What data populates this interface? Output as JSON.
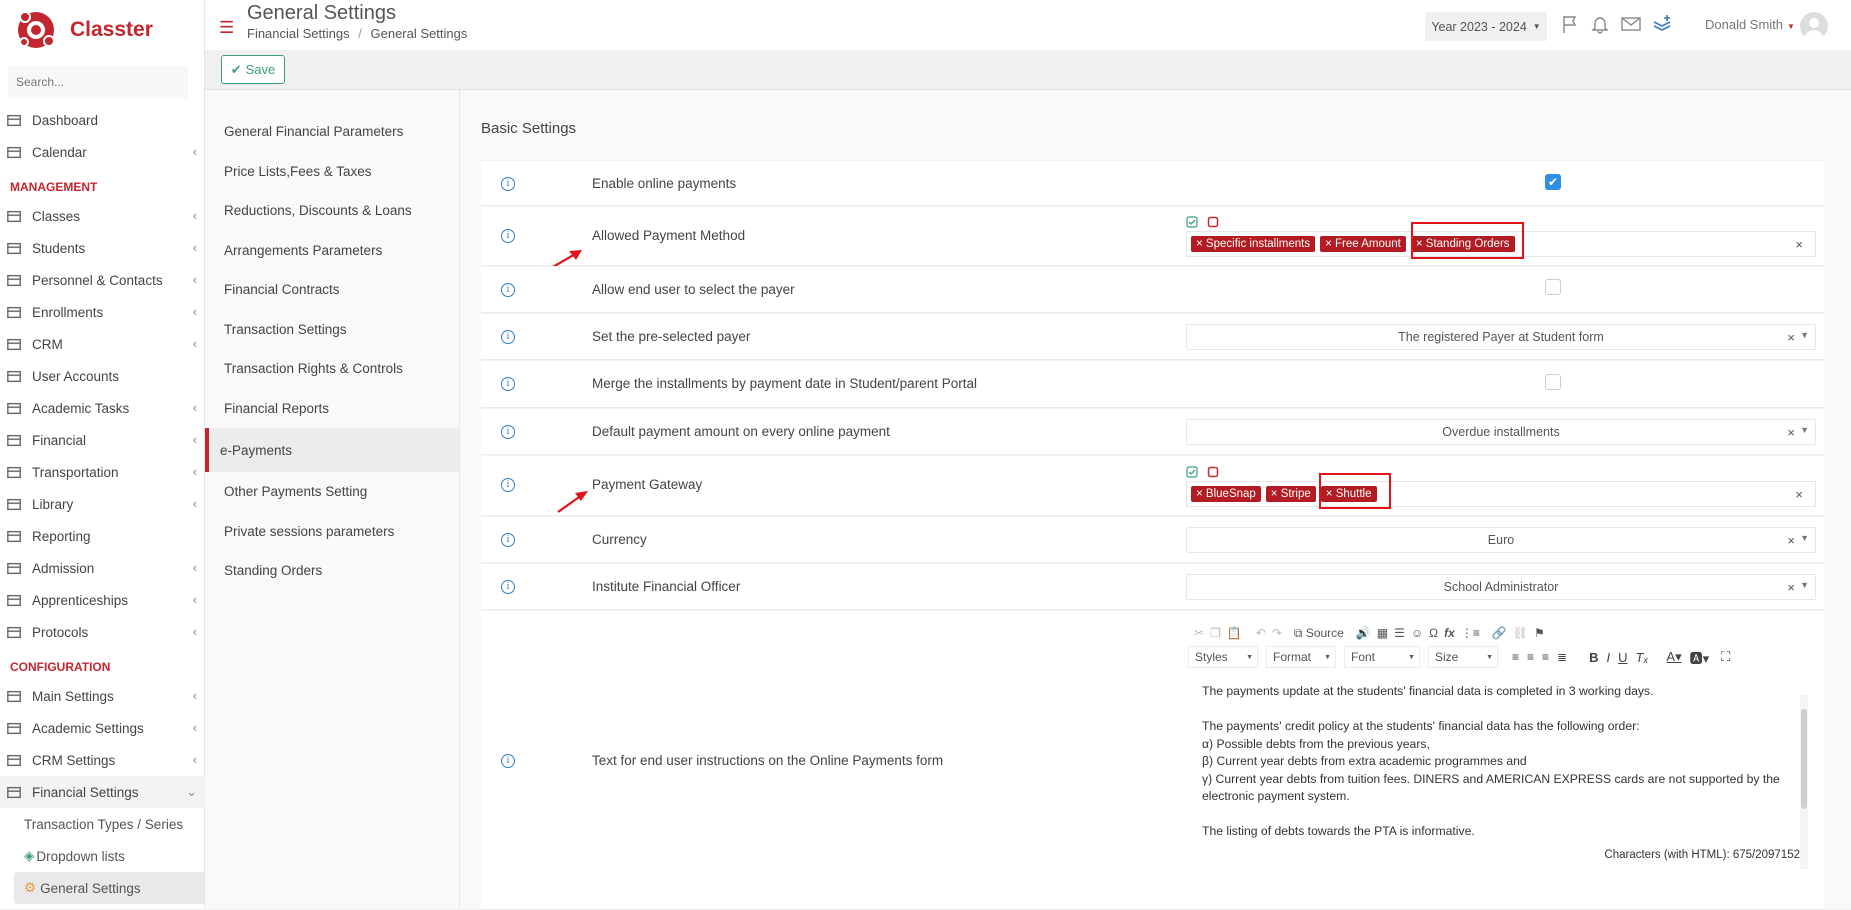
{
  "app": {
    "name": "Classter"
  },
  "sidebar": {
    "search_placeholder": "Search...",
    "items": [
      {
        "label": "Dashboard",
        "chevron": false
      },
      {
        "label": "Calendar",
        "chevron": true
      }
    ],
    "management_title": "MANAGEMENT",
    "management": [
      {
        "label": "Classes",
        "chevron": true
      },
      {
        "label": "Students",
        "chevron": true
      },
      {
        "label": "Personnel & Contacts",
        "chevron": true
      },
      {
        "label": "Enrollments",
        "chevron": true
      },
      {
        "label": "CRM",
        "chevron": true
      },
      {
        "label": "User Accounts",
        "chevron": false
      },
      {
        "label": "Academic Tasks",
        "chevron": true
      },
      {
        "label": "Financial",
        "chevron": true
      },
      {
        "label": "Transportation",
        "chevron": true
      },
      {
        "label": "Library",
        "chevron": true
      },
      {
        "label": "Reporting",
        "chevron": false
      },
      {
        "label": "Admission",
        "chevron": true
      },
      {
        "label": "Apprenticeships",
        "chevron": true
      },
      {
        "label": "Protocols",
        "chevron": true
      }
    ],
    "configuration_title": "CONFIGURATION",
    "configuration": [
      {
        "label": "Main Settings",
        "chevron": true
      },
      {
        "label": "Academic Settings",
        "chevron": true
      },
      {
        "label": "CRM Settings",
        "chevron": true
      },
      {
        "label": "Financial Settings",
        "chevron": "down"
      }
    ],
    "sub_items": [
      "Transaction Types / Series",
      "Dropdown lists",
      "General Settings"
    ]
  },
  "header": {
    "title": "General Settings",
    "breadcrumb": [
      "Financial Settings",
      "General Settings"
    ],
    "breadcrumb_sep": "/",
    "year": "Year 2023 - 2024",
    "user": "Donald Smith"
  },
  "toolbar": {
    "save_label": "Save"
  },
  "subnav": [
    "General Financial Parameters",
    "Price Lists,Fees & Taxes",
    "Reductions, Discounts & Loans",
    "Arrangements Parameters",
    "Financial Contracts",
    "Transaction Settings",
    "Transaction Rights & Controls",
    "Financial Reports",
    "e-Payments",
    "Other Payments Setting",
    "Private sessions parameters",
    "Standing Orders"
  ],
  "subnav_active": "e-Payments",
  "main": {
    "section_title": "Basic Settings",
    "rows": {
      "enable_online": {
        "label": "Enable online payments",
        "checked": true
      },
      "allowed_method": {
        "label": "Allowed Payment Method",
        "tags": [
          "Specific installments",
          "Free Amount",
          "Standing Orders"
        ]
      },
      "allow_payer": {
        "label": "Allow end user to select the payer",
        "checked": false
      },
      "preselected_payer": {
        "label": "Set the pre-selected payer",
        "value": "The registered Payer at Student form"
      },
      "merge": {
        "label": "Merge the installments by payment date in Student/parent Portal",
        "checked": false
      },
      "default_amount": {
        "label": "Default payment amount on every online payment",
        "value": "Overdue installments"
      },
      "gateway": {
        "label": "Payment Gateway",
        "tags": [
          "BlueSnap",
          "Stripe",
          "Shuttle"
        ]
      },
      "currency": {
        "label": "Currency",
        "value": "Euro"
      },
      "officer": {
        "label": "Institute Financial Officer",
        "value": "School Administrator"
      },
      "instructions": {
        "label": "Text for end user instructions on the Online Payments form"
      }
    }
  },
  "editor": {
    "source_label": "Source",
    "styles": "Styles",
    "format": "Format",
    "font": "Font",
    "size": "Size",
    "lines": [
      "The payments update at the students' financial data is completed in 3 working days.",
      "",
      "The payments' credit policy at the students' financial data has the following order:",
      " α) Possible debts from the previous years,",
      " β) Current year debts from extra academic programmes and",
      " γ) Current year debts from tuition fees. DINERS and AMERICAN EXPRESS cards are not supported by the electronic payment system.",
      "",
      "The listing of debts towards the PTA is informative."
    ],
    "char_count": "Characters (with HTML): 675/2097152"
  },
  "colors": {
    "brand": "#c2262f",
    "tag": "#b21c22",
    "highlight": "#e3121b",
    "save": "#3a9f77"
  }
}
